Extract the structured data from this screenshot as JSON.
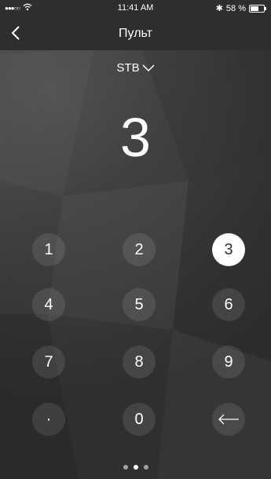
{
  "status": {
    "signal": "●●●○○",
    "wifi_icon": "wifi-icon",
    "time": "11:41 AM",
    "bluetooth": "✱",
    "battery_text": "58 %"
  },
  "nav": {
    "title": "Пульт",
    "back_icon": "chevron-left-icon"
  },
  "device": {
    "selected": "STB"
  },
  "display": {
    "digit": "3"
  },
  "keypad": {
    "keys": [
      "1",
      "2",
      "3",
      "4",
      "5",
      "6",
      "7",
      "8",
      "9",
      "·",
      "0"
    ],
    "active_key": "3",
    "backspace_icon": "arrow-left-icon"
  },
  "pager": {
    "pages": 3,
    "active_page": 2
  }
}
